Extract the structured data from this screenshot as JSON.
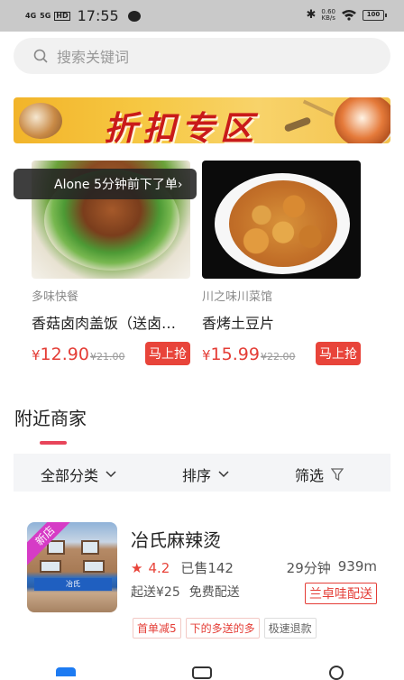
{
  "status": {
    "signal1": "4G",
    "signal2": "5G",
    "hd": "HD",
    "time": "17:55",
    "speed_value": "0.60",
    "speed_unit": "KB/s",
    "battery": "100"
  },
  "search": {
    "placeholder": "搜索关键词"
  },
  "banner": {
    "title": "折扣专区"
  },
  "toast": {
    "text": "Alone 5分钟前下了单›"
  },
  "deals": [
    {
      "shop": "多味快餐",
      "name": "香菇卤肉盖饭（送卤…",
      "price_symbol": "¥",
      "price": "12.90",
      "old_price": "¥21.00",
      "buy_label": "马上抢"
    },
    {
      "shop": "川之味川菜馆",
      "name": "香烤土豆片",
      "price_symbol": "¥",
      "price": "15.99",
      "old_price": "¥22.00",
      "buy_label": "马上抢"
    }
  ],
  "nearby": {
    "title": "附近商家"
  },
  "filters": [
    {
      "label": "全部分类"
    },
    {
      "label": "排序"
    },
    {
      "label": "筛选"
    }
  ],
  "merchant": {
    "badge": "新店",
    "name": "冶氏麻辣烫",
    "rating": "4.2",
    "sold": "已售142",
    "time": "29分钟",
    "distance": "939m",
    "min_order": "起送¥25",
    "delivery_fee": "免费配送",
    "delivery_badge": "兰卓哇配送",
    "sign": "冶氏",
    "tags": [
      "首单减5",
      "下的多送的多",
      "极速退款"
    ]
  },
  "colors": {
    "accent_red": "#e43d36",
    "underline": "#e8455a",
    "nav_active": "#1d7bf2"
  }
}
